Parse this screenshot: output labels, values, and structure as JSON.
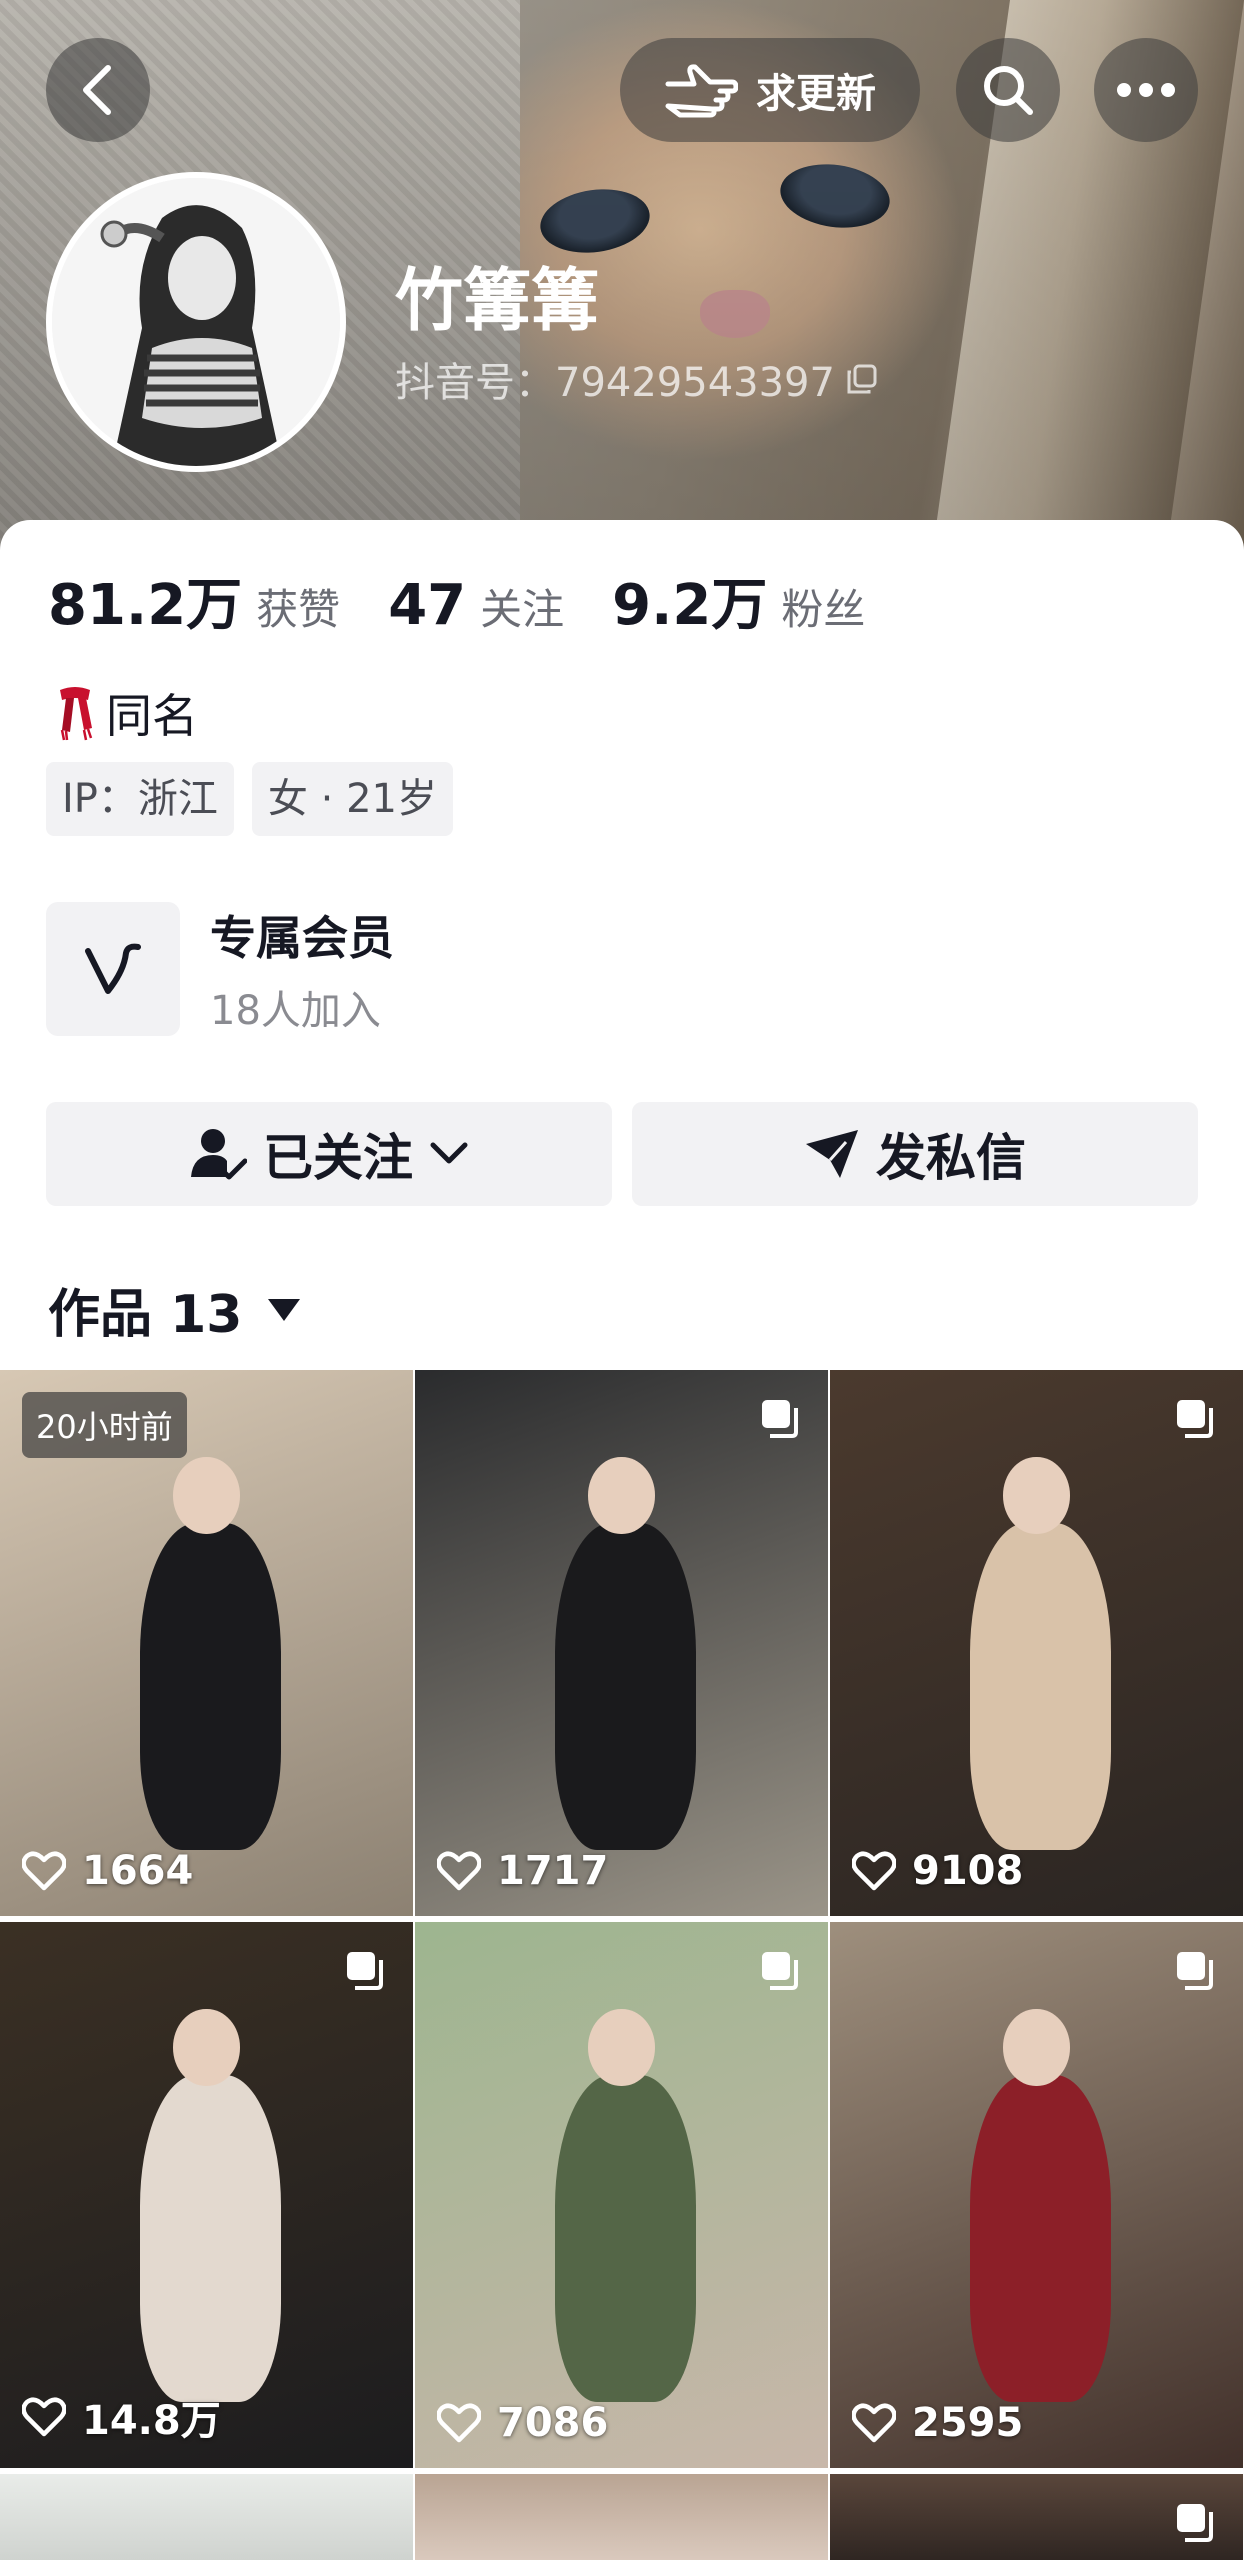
{
  "header": {
    "update_label": "求更新",
    "username": "竹篝篝",
    "douyin_id": "抖音号：79429543397"
  },
  "stats": [
    {
      "value": "81.2万",
      "label": "获赞"
    },
    {
      "value": "47",
      "label": "关注"
    },
    {
      "value": "9.2万",
      "label": "粉丝"
    }
  ],
  "bio": {
    "text": "同名"
  },
  "tags": [
    "IP：浙江",
    "女 · 21岁"
  ],
  "member": {
    "title": "专属会员",
    "subtitle": "18人加入"
  },
  "actions": {
    "follow_label": "已关注",
    "message_label": "发私信"
  },
  "works": {
    "label": "作品 13"
  },
  "grid": {
    "first_badge": "20小时前",
    "items": [
      {
        "likes": "1664",
        "colors": [
          "#d7c8b4",
          "#8c8172",
          "#1a1a1d"
        ]
      },
      {
        "likes": "1717",
        "colors": [
          "#2a2b2d",
          "#9a9488",
          "#1a1a1c"
        ]
      },
      {
        "likes": "9108",
        "colors": [
          "#4b3a2e",
          "#2a2522",
          "#d9c2a9"
        ]
      },
      {
        "likes": "14.8万",
        "colors": [
          "#3b3024",
          "#1c1c1e",
          "#e3d9cf"
        ]
      },
      {
        "likes": "7086",
        "colors": [
          "#9db58f",
          "#c8b7aa",
          "#546647"
        ]
      },
      {
        "likes": "2595",
        "colors": [
          "#9e8f7d",
          "#41302a",
          "#8c1f28"
        ]
      }
    ]
  }
}
